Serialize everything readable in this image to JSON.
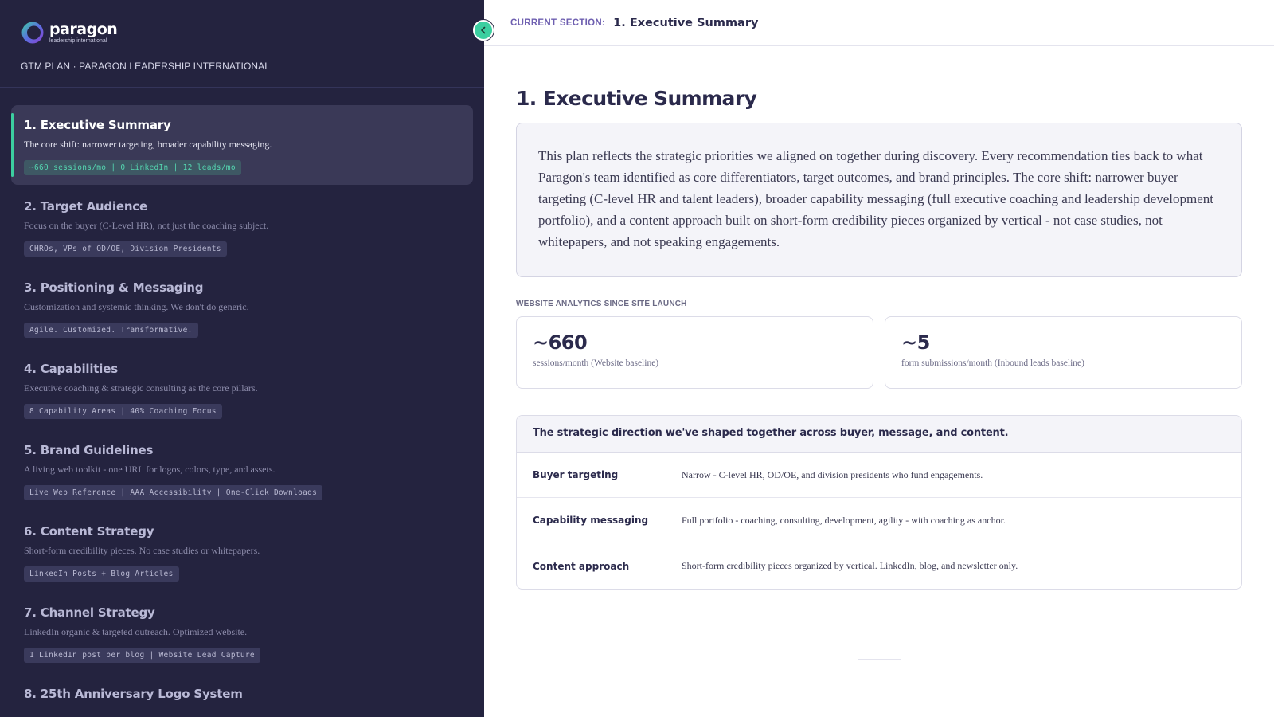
{
  "brand": {
    "name": "paragon",
    "tagline": "leadership international",
    "subtitle": "GTM PLAN · PARAGON LEADERSHIP INTERNATIONAL",
    "accent": "#3ccfa0",
    "sidebar_bg": "#24233f"
  },
  "sidebar": {
    "collapse_icon": "chevron-left-icon",
    "items": [
      {
        "title": "1. Executive Summary",
        "desc": "The core shift: narrower targeting, broader capability messaging.",
        "tag": "~660 sessions/mo | 0 LinkedIn | 12 leads/mo",
        "active": true
      },
      {
        "title": "2. Target Audience",
        "desc": "Focus on the buyer (C-Level HR), not just the coaching subject.",
        "tag": "CHROs, VPs of OD/OE, Division Presidents"
      },
      {
        "title": "3. Positioning & Messaging",
        "desc": "Customization and systemic thinking. We don't do generic.",
        "tag": "Agile. Customized. Transformative."
      },
      {
        "title": "4. Capabilities",
        "desc": "Executive coaching & strategic consulting as the core pillars.",
        "tag": "8 Capability Areas | 40% Coaching Focus"
      },
      {
        "title": "5. Brand Guidelines",
        "desc": "A living web toolkit - one URL for logos, colors, type, and assets.",
        "tag": "Live Web Reference | AAA Accessibility | One-Click Downloads"
      },
      {
        "title": "6. Content Strategy",
        "desc": "Short-form credibility pieces. No case studies or whitepapers.",
        "tag": "LinkedIn Posts + Blog Articles"
      },
      {
        "title": "7. Channel Strategy",
        "desc": "LinkedIn organic & targeted outreach. Optimized website.",
        "tag": "1 LinkedIn post per blog | Website Lead Capture"
      },
      {
        "title": "8. 25th Anniversary Logo System",
        "desc": "",
        "tag": ""
      }
    ]
  },
  "header": {
    "label": "CURRENT SECTION:",
    "value": "1. Executive Summary"
  },
  "main": {
    "title": "1. Executive Summary",
    "summary": "This plan reflects the strategic priorities we aligned on together during discovery. Every recommendation ties back to what Paragon's team identified as core differentiators, target outcomes, and brand principles. The core shift: narrower buyer targeting (C-level HR and talent leaders), broader capability messaging (full executive coaching and leadership development portfolio), and a content approach built on short-form credibility pieces organized by vertical - not case studies, not whitepapers, and not speaking engagements.",
    "analytics_label": "WEBSITE ANALYTICS SINCE SITE LAUNCH",
    "stats": [
      {
        "value": "~660",
        "desc": "sessions/month (Website baseline)"
      },
      {
        "value": "~5",
        "desc": "form submissions/month (Inbound leads baseline)"
      }
    ],
    "direction": {
      "heading": "The strategic direction we've shaped together across buyer, message, and content.",
      "rows": [
        {
          "key": "Buyer targeting",
          "value": "Narrow - C-level HR, OD/OE, and division presidents who fund engagements."
        },
        {
          "key": "Capability messaging",
          "value": "Full portfolio - coaching, consulting, development, agility - with coaching as anchor."
        },
        {
          "key": "Content approach",
          "value": "Short-form credibility pieces organized by vertical. LinkedIn, blog, and newsletter only."
        }
      ]
    }
  }
}
